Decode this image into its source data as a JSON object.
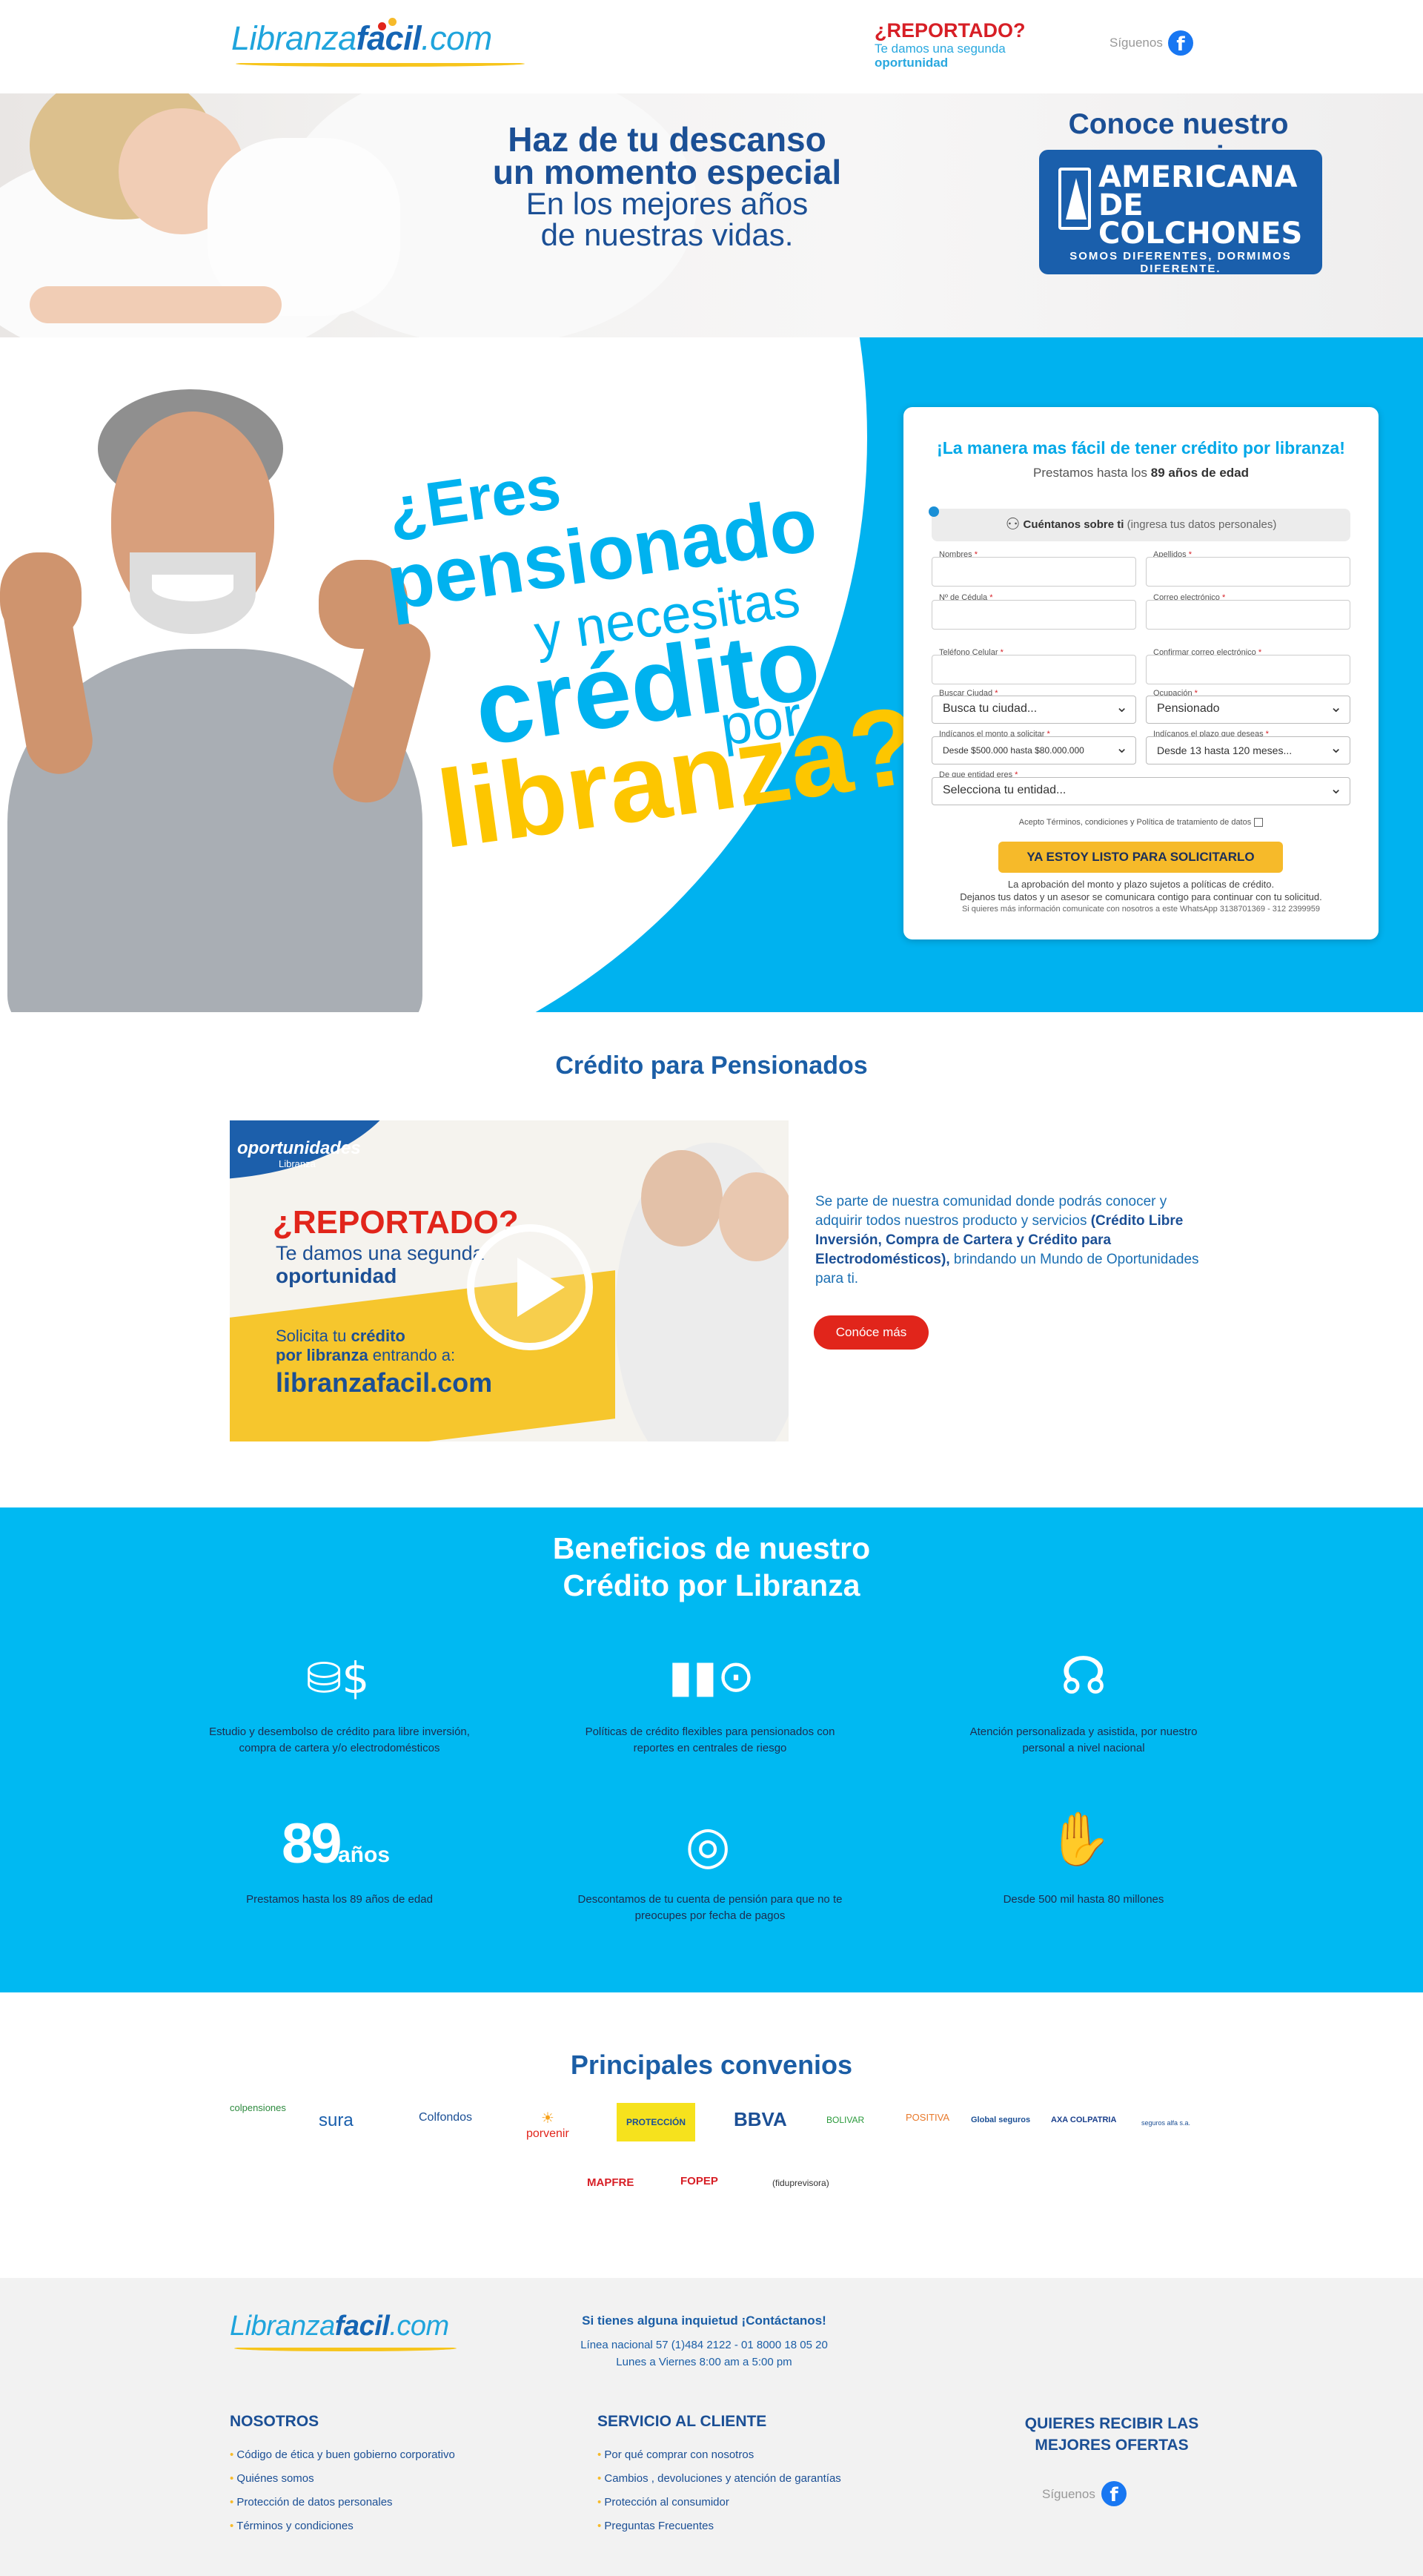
{
  "header": {
    "logo_left": "Libranza",
    "logo_mid": "facil",
    "logo_right": ".com",
    "reportado_title": "¿REPORTADO?",
    "reportado_sub": "Te damos una segunda",
    "reportado_sub2": "oportunidad",
    "follow_label": "Síguenos",
    "facebook_icon": "facebook-icon"
  },
  "banner": {
    "headline1": "Haz de tu descanso",
    "headline2": "un momento especial",
    "headline3": "En los mejores años",
    "headline4": "de nuestras vidas.",
    "convenio_title": "Conoce nuestro convenio",
    "brand_line1": "AMERICANA",
    "brand_line2": "DE COLCHONES",
    "brand_tagline": "SOMOS DIFERENTES, DORMIMOS DIFERENTE."
  },
  "hero": {
    "l1": "¿Eres",
    "l2": "pensionado",
    "l3": "y necesitas",
    "l4": "crédito",
    "l5": "por",
    "l6": "libranza?"
  },
  "form": {
    "title": "¡La manera mas fácil de tener crédito por libranza!",
    "subtitle_pre": "Prestamos hasta los ",
    "subtitle_bold": "89 años de edad",
    "section_bold": "Cuéntanos sobre ti",
    "section_rest": " (ingresa tus datos personales)",
    "fields": {
      "nombres": "Nombres",
      "apellidos": "Apellidos",
      "cedula": "Nº de Cédula",
      "correo": "Correo electrónico",
      "telefono": "Teléfono Celular",
      "confirmar": "Confirmar correo electrónico",
      "ciudad": "Buscar Ciudad",
      "ocupacion": "Ocupación",
      "monto": "Indícanos el monto a solicitar",
      "plazo": "Indícanos el plazo que deseas",
      "entidad": "De que entidad eres"
    },
    "required_mark": "*",
    "selects": {
      "ciudad": "Busca tu ciudad...",
      "ocupacion": "Pensionado",
      "monto": "Desde $500.000 hasta $80.000.000",
      "plazo": "Desde 13 hasta 120 meses...",
      "entidad": "Selecciona tu entidad..."
    },
    "terms": "Acepto Términos, condiciones y Política de tratamiento de datos",
    "submit": "YA ESTOY LISTO PARA SOLICITARLO",
    "note1": "La aprobación del monto y plazo sujetos a políticas de crédito.",
    "note2": "Dejanos tus datos y un asesor se comunicara contigo para continuar con tu solicitud.",
    "note3": "Si quieres más información comunicate con nosotros a este WhatsApp 3138701369 - 312 2399959"
  },
  "credito": {
    "title": "Crédito para Pensionados",
    "video": {
      "brand": "oportunidades",
      "brand_sub": "Libranza",
      "reportado": "¿REPORTADO?",
      "sub": "Te damos una segunda",
      "sub2": "oportunidad",
      "solicita_pre": "Solicita tu ",
      "solicita_bold": "crédito",
      "solicita2_bold": "por libranza",
      "solicita2_rest": " entrando a:",
      "url": "libranzafacil.com",
      "play_icon": "play-icon"
    },
    "text_pre": "Se parte de nuestra comunidad donde podrás conocer y adquirir todos nuestros producto y servicios ",
    "text_bold": "(Crédito Libre Inversión, Compra de Cartera y Crédito para Electrodomésticos),",
    "text_post": " brindando un Mundo de Oportunidades para ti.",
    "button": "Conóce más"
  },
  "beneficios": {
    "title1": "Beneficios de nuestro",
    "title2": "Crédito por Libranza",
    "items": [
      {
        "icon": "money-coins-icon",
        "text": "Estudio y desembolso de crédito para libre inversión, compra de cartera y/o electrodomésticos"
      },
      {
        "icon": "chart-search-icon",
        "text": "Políticas de crédito flexibles para pensionados con reportes en centrales de riesgo"
      },
      {
        "icon": "headset-agent-icon",
        "text": "Atención personalizada y asistida, por nuestro personal a nivel nacional"
      },
      {
        "icon": "age-89-icon",
        "text": "Prestamos hasta los 89 años de edad"
      },
      {
        "icon": "target-money-icon",
        "text": "Descontamos de tu cuenta de pensión para que no te preocupes por fecha de pagos"
      },
      {
        "icon": "money-bag-hand-icon",
        "text": "Desde 500 mil hasta 80 millones"
      }
    ],
    "age_number": "89",
    "age_word": "años"
  },
  "convenios": {
    "title": "Principales convenios",
    "logos": [
      "colpensiones",
      "sura",
      "Colfondos",
      "porvenir",
      "PROTECCIÓN",
      "BBVA",
      "BOLIVAR",
      "POSITIVA",
      "Global seguros",
      "AXA COLPATRIA",
      "seguros alfa s.a.",
      "MAPFRE",
      "FOPEP",
      "(fiduprevisora)"
    ]
  },
  "footer": {
    "contact_title": "Si tienes alguna inquietud ¡Contáctanos!",
    "phone": "Línea nacional 57 (1)484 2122 - 01 8000 18 05 20",
    "hours": "Lunes a Viernes 8:00 am a 5:00 pm",
    "col1_title": "NOSOTROS",
    "col1_items": [
      "Código de ética y buen gobierno corporativo",
      "Quiénes somos",
      "Protección de datos personales",
      "Términos y condiciones"
    ],
    "col2_title": "SERVICIO AL CLIENTE",
    "col2_items": [
      "Por qué comprar con nosotros",
      "Cambios , devoluciones y atención de garantías",
      "Protección al consumidor",
      "Preguntas Frecuentes"
    ],
    "col3_title1": "QUIERES RECIBIR LAS",
    "col3_title2": "MEJORES OFERTAS",
    "follow_label": "Síguenos"
  }
}
